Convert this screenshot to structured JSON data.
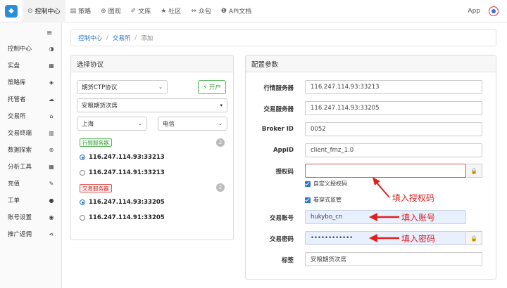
{
  "topnav": {
    "items": [
      {
        "label": "控制中心",
        "icon": "gauge-icon",
        "glyph": "⊙"
      },
      {
        "label": "策略",
        "icon": "strategy-icon",
        "glyph": "▤"
      },
      {
        "label": "图观",
        "icon": "view-icon",
        "glyph": "⊕"
      },
      {
        "label": "文库",
        "icon": "library-icon",
        "glyph": "✐"
      },
      {
        "label": "社区",
        "icon": "community-icon",
        "glyph": "★"
      },
      {
        "label": "众包",
        "icon": "crowdsource-icon",
        "glyph": "⇔"
      },
      {
        "label": "API文档",
        "icon": "api-doc-icon",
        "glyph": "❶"
      }
    ],
    "app_label": "App"
  },
  "sidebar": {
    "items": [
      {
        "label": "控制中心",
        "glyph": "◑"
      },
      {
        "label": "实盘",
        "glyph": "▦"
      },
      {
        "label": "策略库",
        "glyph": "◈"
      },
      {
        "label": "托管者",
        "glyph": "☁"
      },
      {
        "label": "交易所",
        "glyph": "⌂"
      },
      {
        "label": "交易终端",
        "glyph": "▥"
      },
      {
        "label": "数据探索",
        "glyph": "⊚"
      },
      {
        "label": "分析工具",
        "glyph": "▦"
      },
      {
        "label": "充值",
        "glyph": "✎"
      },
      {
        "label": "工单",
        "glyph": "●"
      },
      {
        "label": "账号设置",
        "glyph": "◉"
      },
      {
        "label": "推广返佣",
        "glyph": "⋖"
      }
    ]
  },
  "breadcrumb": {
    "items": [
      "控制中心",
      "交易所",
      "添加"
    ]
  },
  "protocol": {
    "title": "选择协议",
    "protocol_select": "期货CTP协议",
    "open_button": "⚡ 开户",
    "broker_select": "安粮期货次席",
    "region_select": "上海",
    "carrier_select": "电信",
    "market_tag": "行情服务器",
    "market_count": "2",
    "market_servers": [
      "116.247.114.93:33213",
      "116.247.114.91:33213"
    ],
    "trade_tag": "交易服务器",
    "trade_count": "2",
    "trade_servers": [
      "116.247.114.93:33205",
      "116.247.114.91:33205"
    ]
  },
  "config": {
    "title": "配置参数",
    "market_server_label": "行情服务器",
    "market_server_value": "116.247.114.93:33213",
    "trade_server_label": "交易服务器",
    "trade_server_value": "116.247.114.93:33205",
    "broker_id_label": "Broker ID",
    "broker_id_value": "0052",
    "appid_label": "AppID",
    "appid_value": "client_fmz_1.0",
    "auth_code_label": "授权码",
    "auth_code_value": "",
    "custom_auth_label": "自定义授权码",
    "penetration_label": "看穿式监管",
    "account_label": "交易账号",
    "account_value": "hukybo_cn",
    "password_label": "交易密码",
    "password_value": "••••••••••••",
    "tag_label": "标签",
    "tag_value": "安粮期货次席"
  },
  "annotations": {
    "auth": "填入授权码",
    "account": "填入账号",
    "password": "填入密码"
  },
  "colors": {
    "accent": "#2b74c4",
    "error": "#d9534f",
    "annotation": "#e02020"
  }
}
